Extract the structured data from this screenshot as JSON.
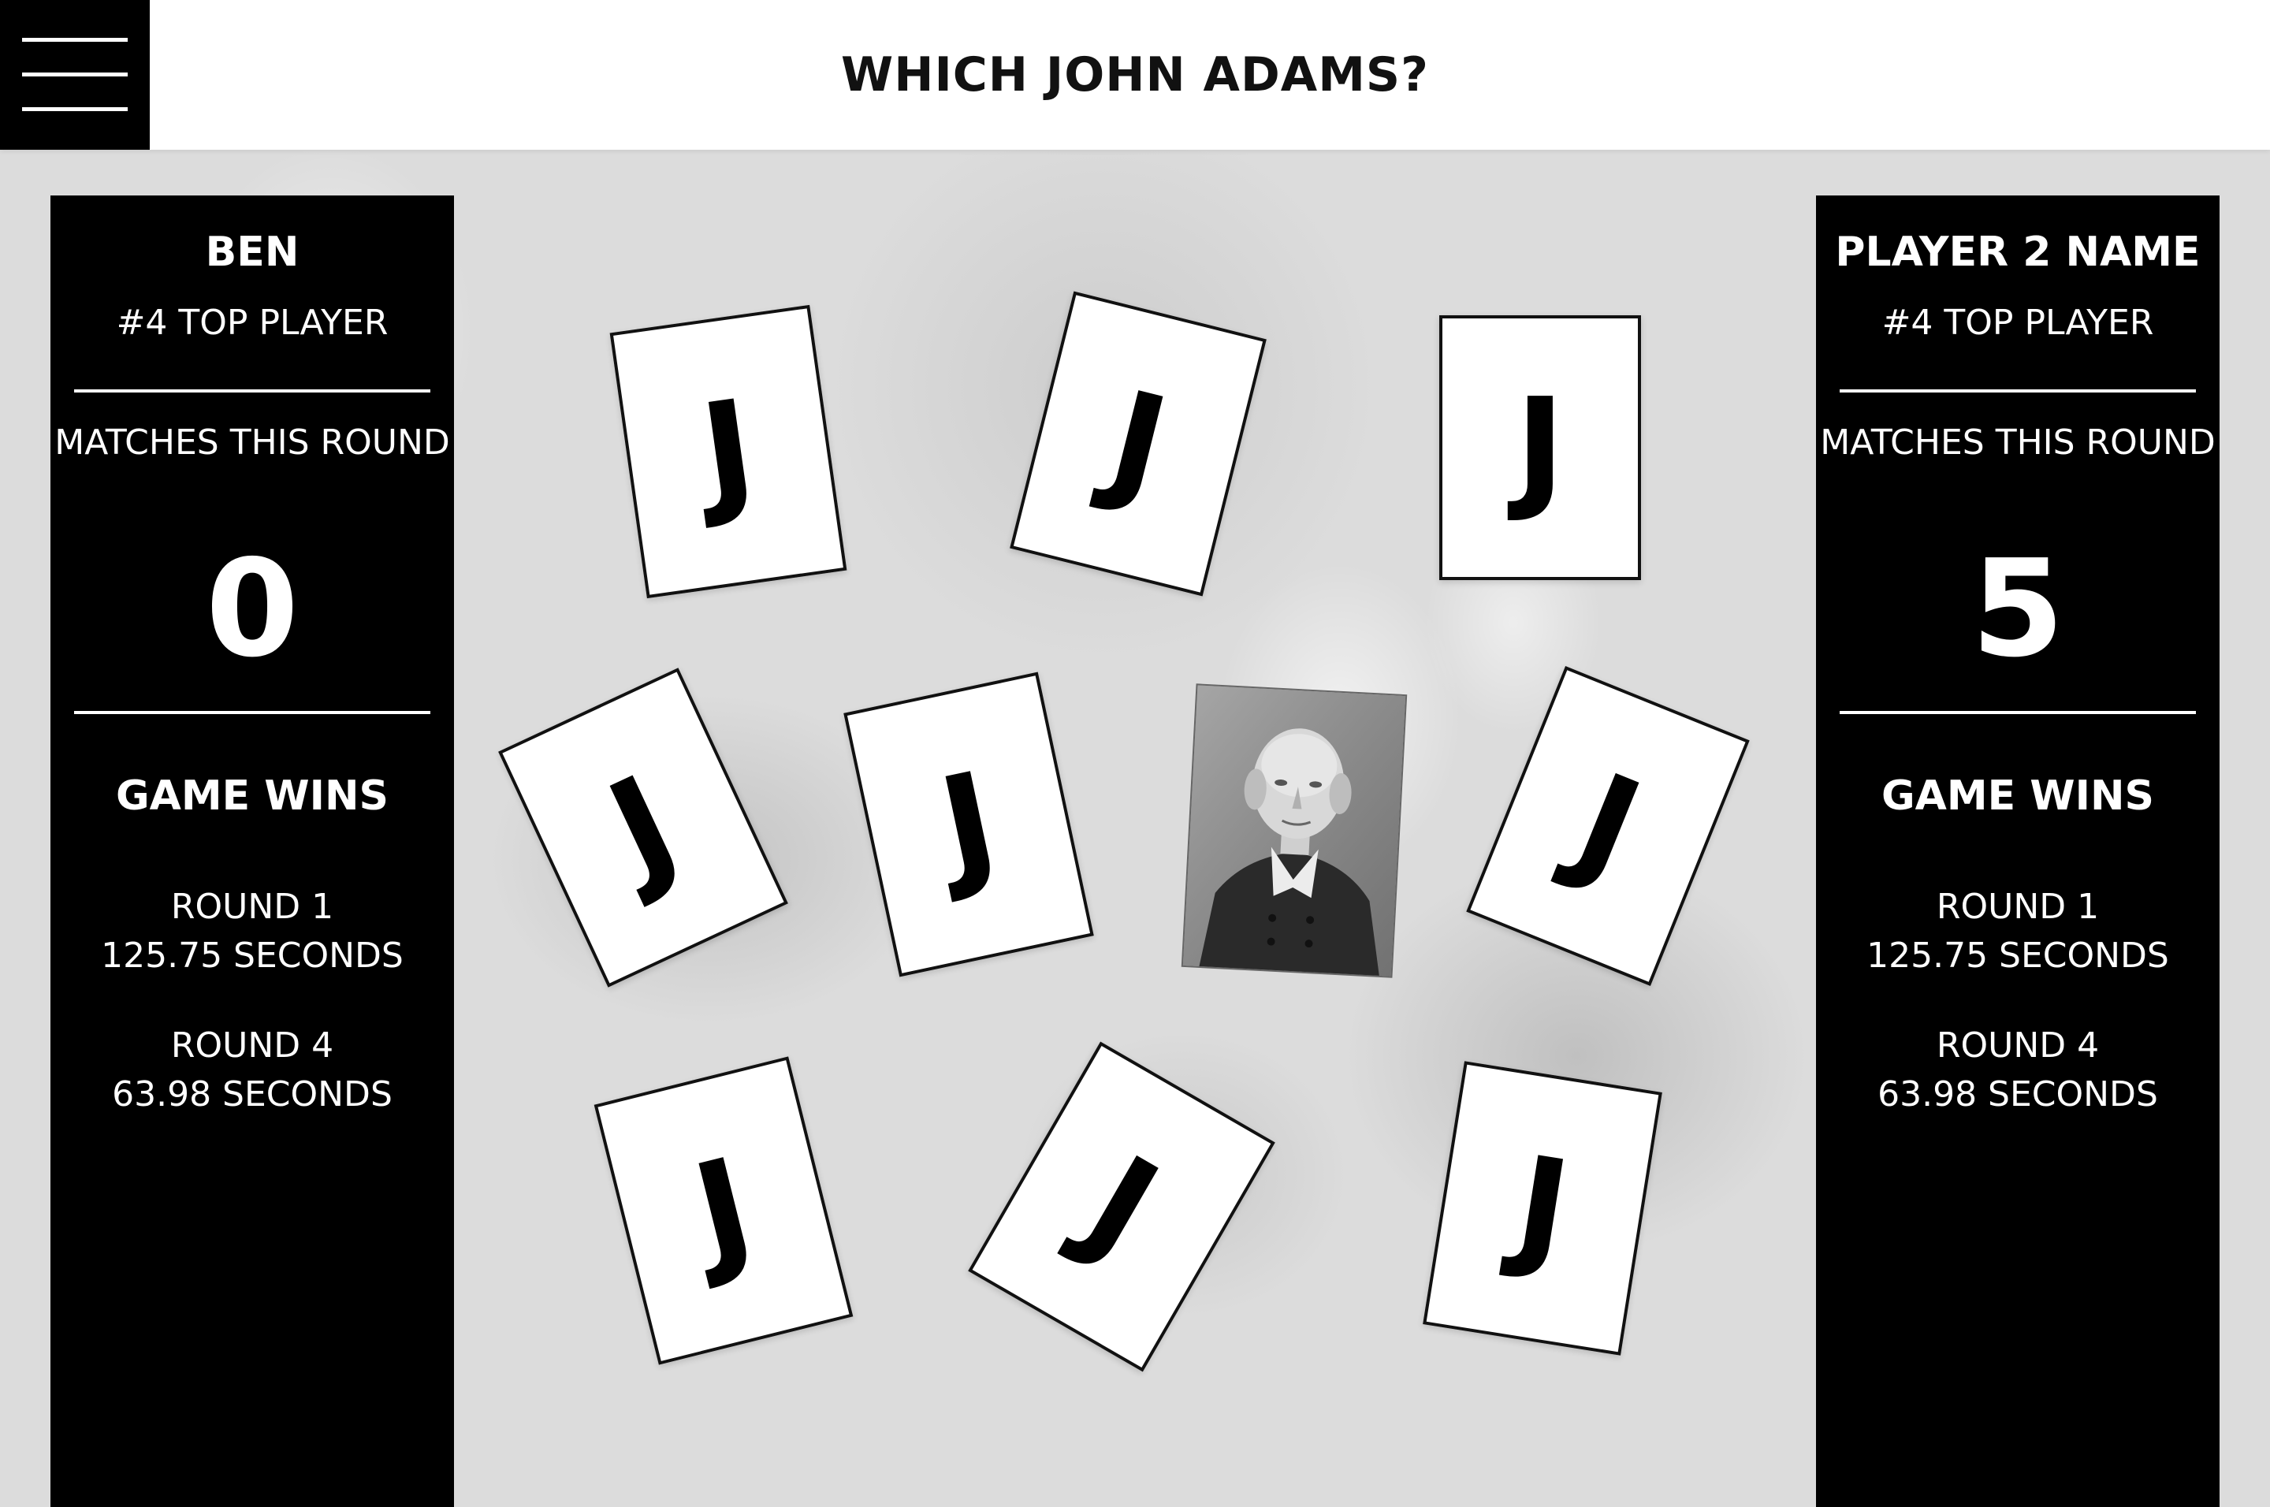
{
  "header": {
    "title": "WHICH JOHN ADAMS?"
  },
  "players": [
    {
      "name": "BEN",
      "rank": "#4 TOP PLAYER",
      "matches_label": "MATCHES THIS ROUND",
      "matches_value": "0",
      "wins_label": "GAME WINS",
      "rounds": [
        {
          "round": "ROUND 1",
          "time": "125.75 SECONDS"
        },
        {
          "round": "ROUND 4",
          "time": "63.98 SECONDS"
        }
      ]
    },
    {
      "name": "PLAYER 2 NAME",
      "rank": "#4 TOP PLAYER",
      "matches_label": "MATCHES THIS ROUND",
      "matches_value": "5",
      "wins_label": "GAME WINS",
      "rounds": [
        {
          "round": "ROUND 1",
          "time": "125.75 SECONDS"
        },
        {
          "round": "ROUND 4",
          "time": "63.98 SECONDS"
        }
      ]
    }
  ],
  "board": {
    "cards": [
      {
        "label": "J"
      },
      {
        "label": "J"
      },
      {
        "label": "J"
      },
      {
        "label": "J"
      },
      {
        "label": "J"
      },
      {
        "label": "J"
      },
      {
        "label": "J"
      },
      {
        "label": "J"
      },
      {
        "label": "J"
      }
    ],
    "revealed_card": "portrait"
  }
}
